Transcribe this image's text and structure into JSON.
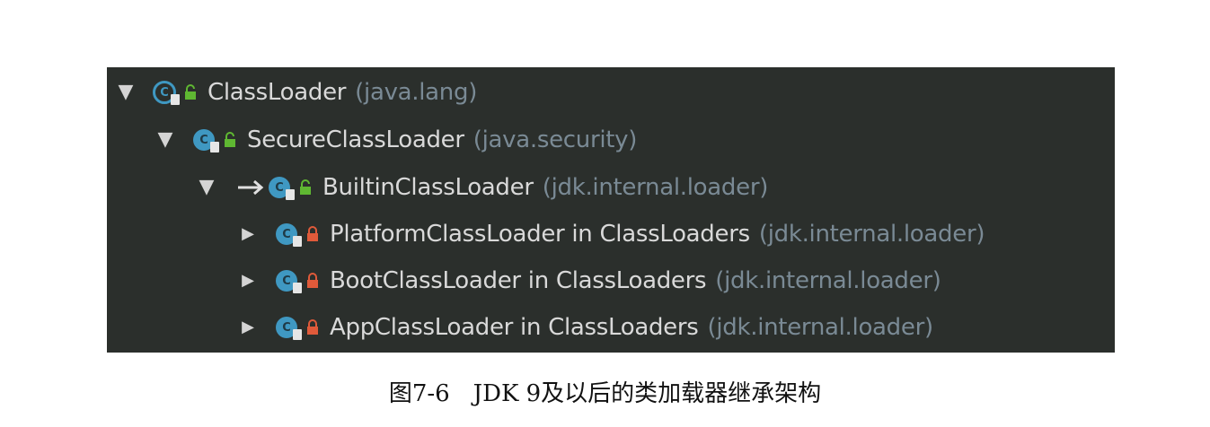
{
  "tree": {
    "rows": [
      {
        "expanded": true,
        "name": "ClassLoader",
        "package": "(java.lang)",
        "icon": "abstract-class-icon",
        "access": "public"
      },
      {
        "expanded": true,
        "name": "SecureClassLoader",
        "package": "(java.security)",
        "icon": "class-icon",
        "access": "public"
      },
      {
        "expanded": true,
        "name": "BuiltinClassLoader",
        "package": "(jdk.internal.loader)",
        "icon": "class-icon",
        "access": "public"
      },
      {
        "expanded": false,
        "name": "PlatformClassLoader in ClassLoaders",
        "package": "(jdk.internal.loader)",
        "icon": "class-icon",
        "access": "private"
      },
      {
        "expanded": false,
        "name": "BootClassLoader in ClassLoaders",
        "package": "(jdk.internal.loader)",
        "icon": "class-icon",
        "access": "private"
      },
      {
        "expanded": false,
        "name": "AppClassLoader in ClassLoaders",
        "package": "(jdk.internal.loader)",
        "icon": "class-icon",
        "access": "private"
      }
    ],
    "icon_letter": "C"
  },
  "colors": {
    "panel_bg": "#2b2f2c",
    "class_icon": "#3f98c2",
    "public_lock": "#5fb832",
    "private_lock": "#e05a3a",
    "label_text": "#d9d9d9",
    "package_text": "#7a8a95"
  },
  "caption": "图7-6　JDK 9及以后的类加载器继承架构"
}
